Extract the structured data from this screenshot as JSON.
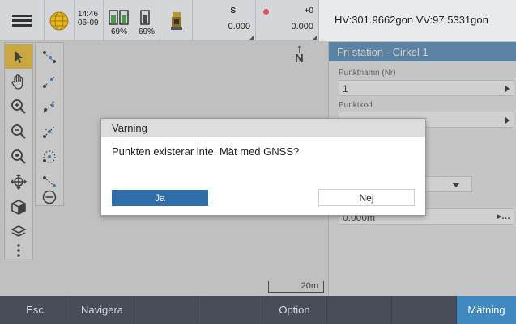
{
  "statusbar": {
    "time": "14:46",
    "date": "06-09",
    "battery1": "69%",
    "battery2": "69%",
    "s_label": "S",
    "s_value": "0.000",
    "target_label": "+0",
    "target_value": "0.000",
    "hv_readout": "HV:301.9662gon  VV:97.5331gon"
  },
  "map": {
    "north_label": "N",
    "scale_label": "20m"
  },
  "panel": {
    "title": "Fri station - Cirkel 1",
    "point_name_label": "Punktnamn (Nr)",
    "point_name_value": "1",
    "point_code_label": "Punktkod",
    "height_value": "0.000m",
    "more_label": "..."
  },
  "dialog": {
    "title": "Varning",
    "message": "Punkten existerar inte. Mät med GNSS?",
    "yes_label": "Ja",
    "no_label": "Nej"
  },
  "bottombar": {
    "esc": "Esc",
    "navigate": "Navigera",
    "option": "Option",
    "measure": "Mätning"
  },
  "colors": {
    "accent": "#3f88c0",
    "selected_tool": "#f5c11f",
    "dialog_primary": "#2f6eaa"
  }
}
